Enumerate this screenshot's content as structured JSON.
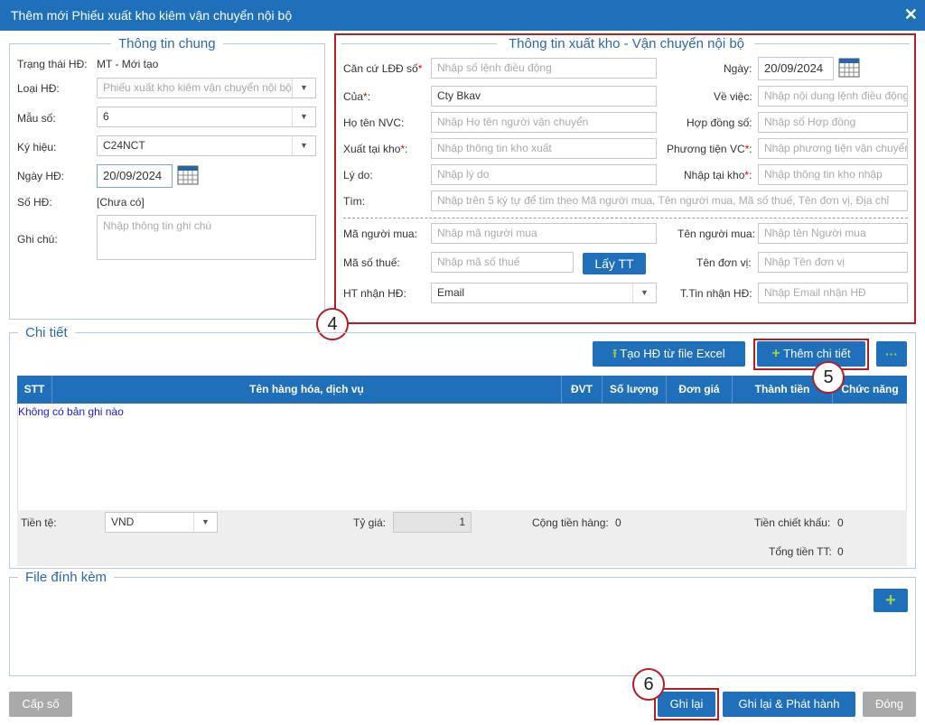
{
  "dialog": {
    "title": "Thêm mới Phiếu xuất kho kiêm vận chuyển nội bộ",
    "close_glyph": "✕"
  },
  "general": {
    "legend": "Thông tin chung",
    "status_label": "Trạng thái HĐ:",
    "status_value": "MT - Mới tạo",
    "type_label": "Loại HĐ:",
    "type_value": "Phiếu xuất kho kiêm vận chuyển nội bộ",
    "template_label": "Mẫu số:",
    "template_value": "6",
    "symbol_label": "Ký hiệu:",
    "symbol_value": "C24NCT",
    "date_label": "Ngày HĐ:",
    "date_value": "20/09/2024",
    "number_label": "Số HĐ:",
    "number_value": "[Chưa có]",
    "note_label": "Ghi chú:",
    "note_placeholder": "Nhập thông tin ghi chú"
  },
  "transport": {
    "legend": "Thông tin xuất kho - Vận chuyển nội bộ",
    "order_label": "Căn cứ LĐĐ số",
    "order_placeholder": "Nhập số lệnh điều động",
    "date_label": "Ngày:",
    "date_value": "20/09/2024",
    "of_label": "Của",
    "of_value": "Cty Bkav",
    "subject_label": "Về việc:",
    "subject_placeholder": "Nhập nội dung lệnh điều động",
    "carrier_label": "Họ tên NVC:",
    "carrier_placeholder": "Nhập Họ tên người vận chuyển",
    "contract_label": "Hợp đồng số:",
    "contract_placeholder": "Nhập số Hợp đồng",
    "from_label": "Xuất tại kho",
    "from_placeholder": "Nhập thông tin kho xuất",
    "vehicle_label": "Phương tiện VC",
    "vehicle_placeholder": "Nhập phương tiện vận chuyển",
    "reason_label": "Lý do:",
    "reason_placeholder": "Nhập lý do",
    "to_label": "Nhập tại kho",
    "to_placeholder": "Nhập thông tin kho nhập",
    "search_label": "Tìm:",
    "search_placeholder": "Nhập trên 5 ký tự để tìm theo Mã người mua, Tên người mua, Mã số thuế, Tên đơn vị, Địa chỉ",
    "buyer_code_label": "Mã người mua:",
    "buyer_code_placeholder": "Nhập mã người mua",
    "buyer_name_label": "Tên người mua:",
    "buyer_name_placeholder": "Nhập tên Người mua",
    "tax_label": "Mã số thuế:",
    "tax_placeholder": "Nhập mã số thuế",
    "fetch_button": "Lấy TT",
    "unit_label": "Tên đơn vị:",
    "unit_placeholder": "Nhập Tên đơn vị",
    "receive_method_label": "HT nhận HĐ:",
    "receive_method_value": "Email",
    "receive_info_label": "T.Tin nhận HĐ:",
    "receive_info_placeholder": "Nhập Email nhận HĐ",
    "required_mark": "*"
  },
  "detail": {
    "legend": "Chi tiết",
    "excel_button": "Tạo HĐ từ file Excel",
    "add_button": "Thêm chi tiết",
    "more_button": "···",
    "columns": [
      "STT",
      "Tên hàng hóa, dịch vụ",
      "ĐVT",
      "Số lượng",
      "Đơn giá",
      "Thành tiền",
      "Chức năng"
    ],
    "empty_text": "Không có bản ghi nào",
    "currency_label": "Tiền tệ:",
    "currency_value": "VND",
    "rate_label": "Tỷ giá:",
    "rate_value": "1",
    "subtotal_label": "Cộng tiền hàng:",
    "subtotal_value": "0",
    "discount_label": "Tiền chiết khấu:",
    "discount_value": "0",
    "total_label": "Tổng tiền TT:",
    "total_value": "0"
  },
  "attachments": {
    "legend": "File đính kèm",
    "add_glyph": "+"
  },
  "actions": {
    "issue_number": "Cấp số",
    "save": "Ghi lại",
    "save_publish": "Ghi lại & Phát hành",
    "close": "Đóng"
  },
  "callouts": {
    "c4": "4",
    "c5": "5",
    "c6": "6"
  },
  "colors": {
    "primary": "#1f6fba",
    "callout": "#b11e24",
    "required": "#d00000",
    "legend": "#2a67b1"
  }
}
